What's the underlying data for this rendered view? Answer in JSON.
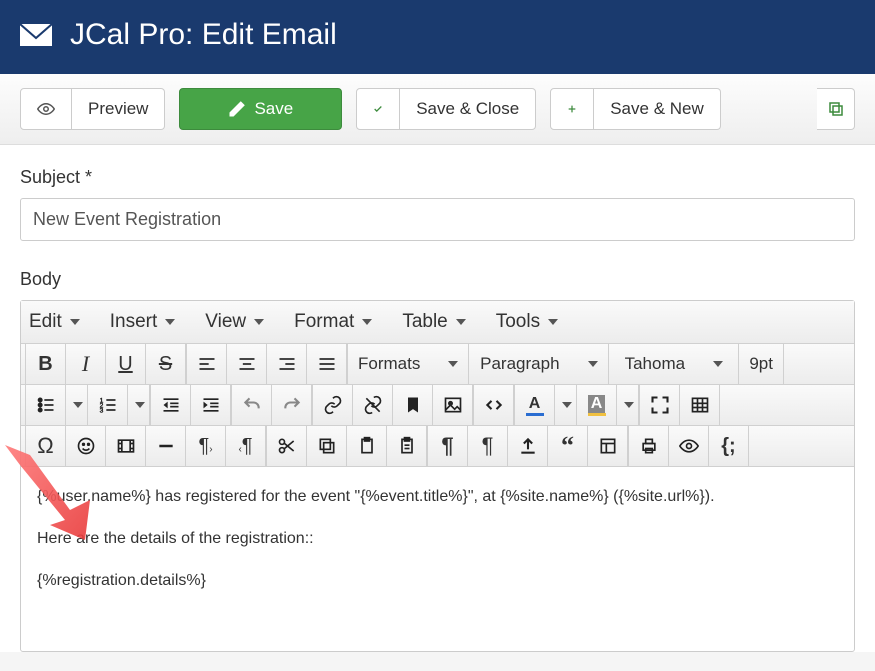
{
  "header": {
    "title": "JCal Pro: Edit Email"
  },
  "toolbar": {
    "preview": "Preview",
    "save": "Save",
    "save_close": "Save & Close",
    "save_new": "Save & New"
  },
  "form": {
    "subject_label": "Subject *",
    "subject_value": "New Event Registration",
    "body_label": "Body"
  },
  "editor_menus": {
    "edit": "Edit",
    "insert": "Insert",
    "view": "View",
    "format": "Format",
    "table": "Table",
    "tools": "Tools"
  },
  "editor_selects": {
    "formats": "Formats",
    "paragraph": "Paragraph",
    "font": "Tahoma",
    "size": "9pt"
  },
  "body_content": {
    "p1": "{%user.name%} has registered for the event \"{%event.title%}\", at {%site.name%} ({%site.url%}).",
    "p2": "Here are the details of the registration::",
    "p3": "{%registration.details%}"
  }
}
